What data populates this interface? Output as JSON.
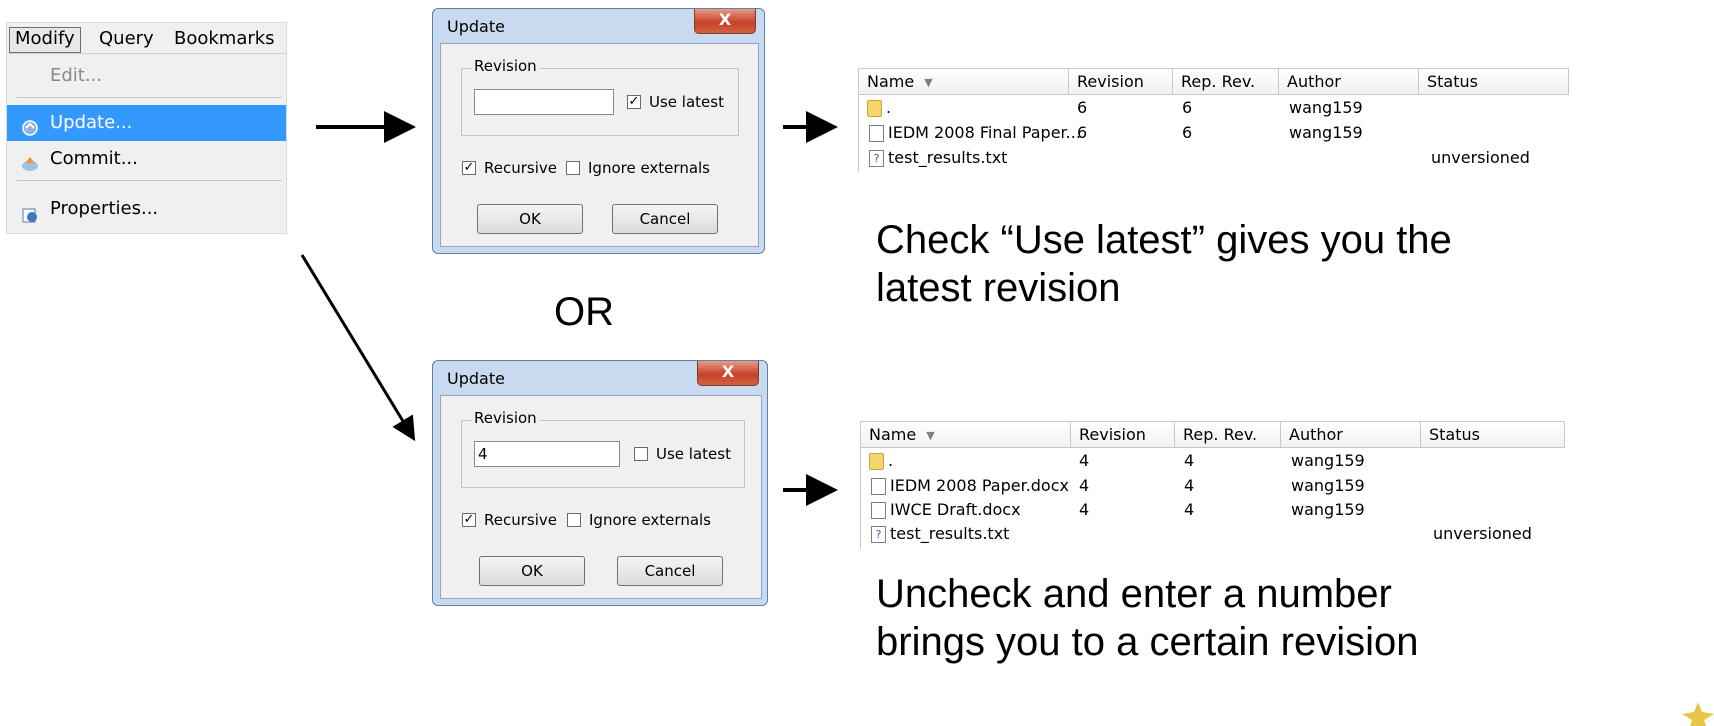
{
  "menu": {
    "bar": [
      "Modify",
      "Query",
      "Bookmarks"
    ],
    "items": [
      {
        "label": "Edit..."
      },
      {
        "label": "Update..."
      },
      {
        "label": "Commit..."
      },
      {
        "label": "Properties..."
      }
    ]
  },
  "dialog_latest": {
    "title": "Update",
    "close": "X",
    "group_label": "Revision",
    "revision_value": "",
    "use_latest_label": "Use latest",
    "recursive_label": "Recursive",
    "ignore_label": "Ignore externals",
    "ok_label": "OK",
    "cancel_label": "Cancel"
  },
  "dialog_revision": {
    "title": "Update",
    "close": "X",
    "group_label": "Revision",
    "revision_value": "4",
    "use_latest_label": "Use latest",
    "recursive_label": "Recursive",
    "ignore_label": "Ignore externals",
    "ok_label": "OK",
    "cancel_label": "Cancel"
  },
  "or_label": "OR",
  "table_latest": {
    "headers": [
      "Name",
      "Revision",
      "Rep. Rev.",
      "Author",
      "Status"
    ],
    "rows": [
      {
        "name": ".",
        "revision": "6",
        "rep_rev": "6",
        "author": "wang159",
        "status": ""
      },
      {
        "name": "IEDM 2008 Final Paper...",
        "revision": "6",
        "rep_rev": "6",
        "author": "wang159",
        "status": ""
      },
      {
        "name": "test_results.txt",
        "revision": "",
        "rep_rev": "",
        "author": "",
        "status": "unversioned"
      }
    ]
  },
  "table_revision": {
    "headers": [
      "Name",
      "Revision",
      "Rep. Rev.",
      "Author",
      "Status"
    ],
    "rows": [
      {
        "name": ".",
        "revision": "4",
        "rep_rev": "4",
        "author": "wang159",
        "status": ""
      },
      {
        "name": "IEDM 2008 Paper.docx",
        "revision": "4",
        "rep_rev": "4",
        "author": "wang159",
        "status": ""
      },
      {
        "name": "IWCE Draft.docx",
        "revision": "4",
        "rep_rev": "4",
        "author": "wang159",
        "status": ""
      },
      {
        "name": "test_results.txt",
        "revision": "",
        "rep_rev": "",
        "author": "",
        "status": "unversioned"
      }
    ]
  },
  "captions": {
    "latest": [
      "Check “Use latest” gives you the",
      "latest revision"
    ],
    "revision": [
      "Uncheck and enter a number",
      "brings you to a certain revision"
    ]
  }
}
